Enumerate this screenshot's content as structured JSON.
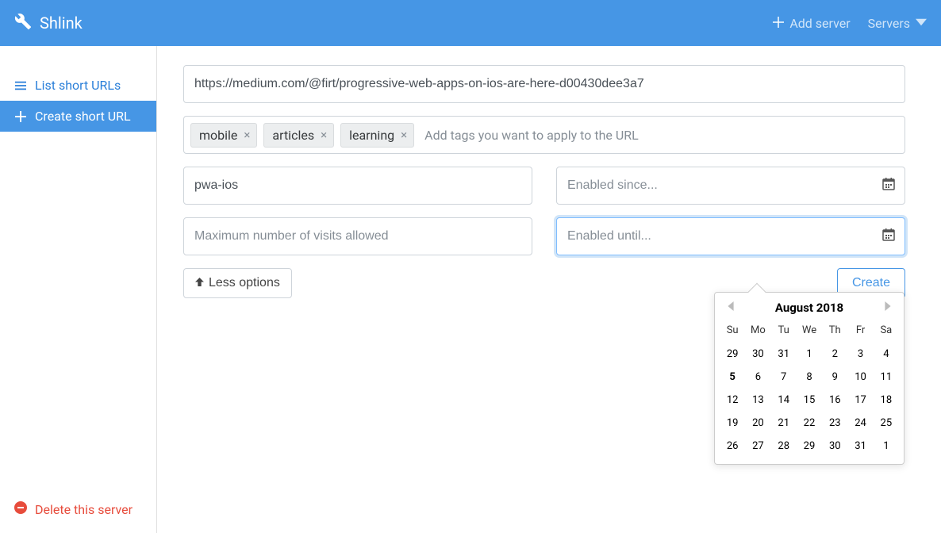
{
  "brand": "Shlink",
  "top": {
    "add_server": "Add server",
    "servers": "Servers"
  },
  "sidebar": {
    "list": "List short URLs",
    "create": "Create short URL",
    "delete": "Delete this server"
  },
  "form": {
    "url": "https://medium.com/@firt/progressive-web-apps-on-ios-are-here-d00430dee3a7",
    "tags": [
      "mobile",
      "articles",
      "learning"
    ],
    "tags_placeholder": "Add tags you want to apply to the URL",
    "slug": "pwa-ios",
    "max_visits_placeholder": "Maximum number of visits allowed",
    "enabled_since_placeholder": "Enabled since...",
    "enabled_until_placeholder": "Enabled until...",
    "less_options": "Less options",
    "create": "Create"
  },
  "datepicker": {
    "title": "August 2018",
    "dow": [
      "Su",
      "Mo",
      "Tu",
      "We",
      "Th",
      "Fr",
      "Sa"
    ],
    "weeks": [
      [
        29,
        30,
        31,
        1,
        2,
        3,
        4
      ],
      [
        5,
        6,
        7,
        8,
        9,
        10,
        11
      ],
      [
        12,
        13,
        14,
        15,
        16,
        17,
        18
      ],
      [
        19,
        20,
        21,
        22,
        23,
        24,
        25
      ],
      [
        26,
        27,
        28,
        29,
        30,
        31,
        1
      ]
    ],
    "today": 5
  }
}
